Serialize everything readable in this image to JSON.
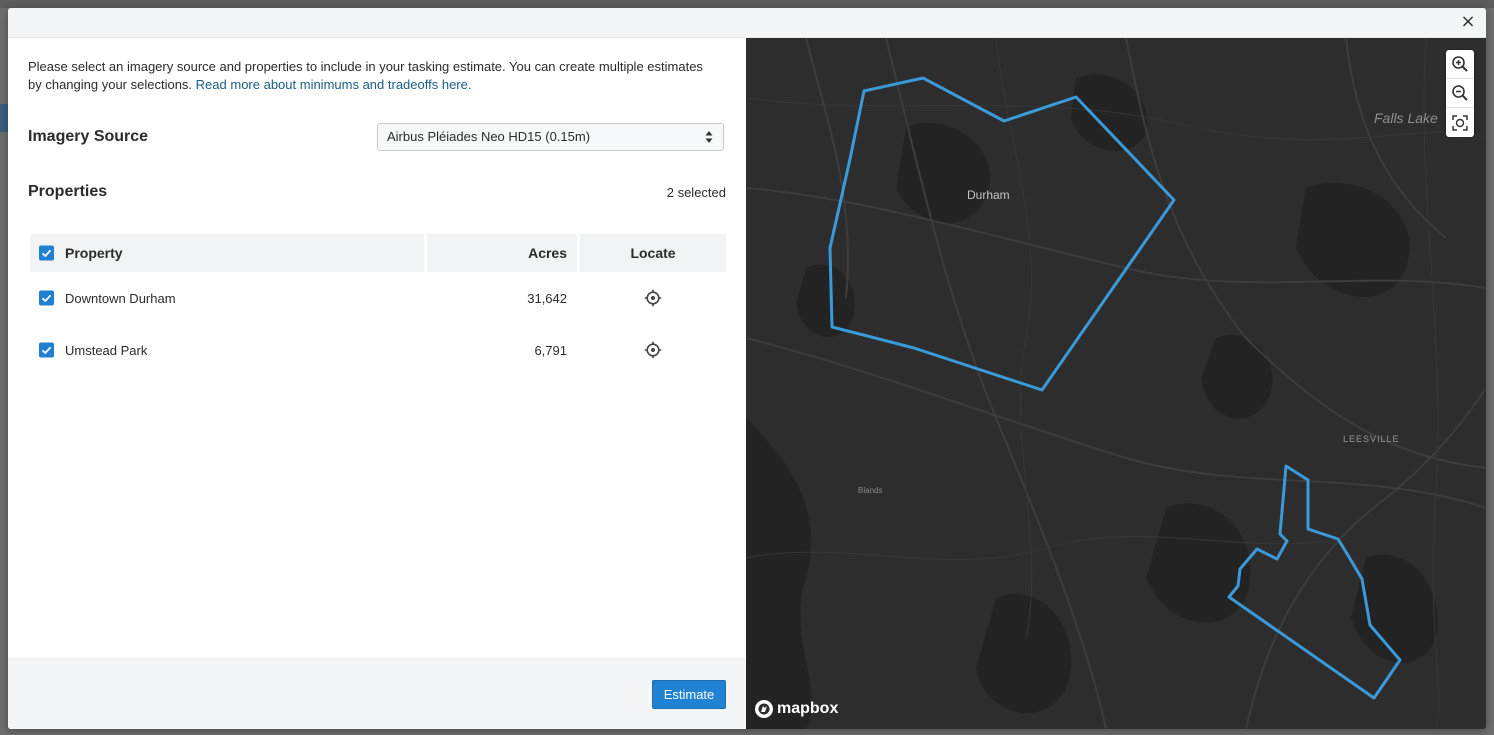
{
  "modal": {
    "close_label": "×"
  },
  "intro": {
    "text": "Please select an imagery source and properties to include in your tasking estimate. You can create multiple estimates by changing your selections.",
    "link": "Read more about minimums and tradeoffs here."
  },
  "imagery": {
    "label": "Imagery Source",
    "selected": "Airbus Pléiades Neo HD15 (0.15m)"
  },
  "properties": {
    "label": "Properties",
    "selected_count": "2 selected",
    "columns": {
      "property": "Property",
      "acres": "Acres",
      "locate": "Locate"
    },
    "all_checked": true,
    "rows": [
      {
        "name": "Downtown Durham",
        "acres": "31,642",
        "checked": true
      },
      {
        "name": "Umstead Park",
        "acres": "6,791",
        "checked": true
      }
    ]
  },
  "footer": {
    "estimate_label": "Estimate"
  },
  "map": {
    "labels": {
      "durham": "Durham",
      "falls_lake": "Falls Lake",
      "leesville": "LEESVILLE",
      "blands": "Blands"
    },
    "attribution": "mapbox",
    "controls": [
      "zoom-in-icon",
      "zoom-out-icon",
      "fit-bounds-icon"
    ],
    "polygon_color": "#3a9ad9",
    "accent": "#1f82d2"
  }
}
